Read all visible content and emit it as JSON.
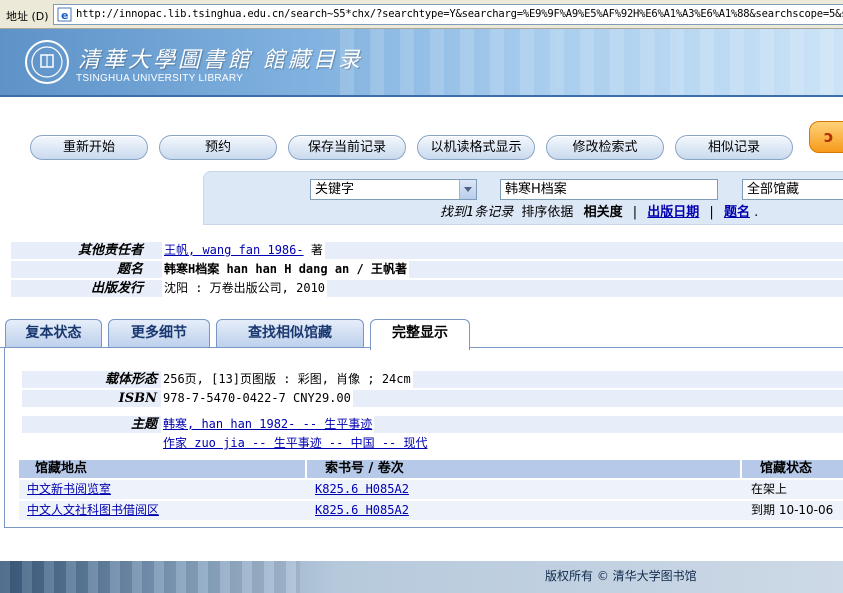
{
  "address_bar": {
    "label": "地址 (D)",
    "url": "http://innopac.lib.tsinghua.edu.cn/search~S5*chx/?searchtype=Y&searcharg=%E9%9F%A9%E5%AF%92H%E6%A1%A3%E6%A1%88&searchscope=5&sor"
  },
  "header": {
    "title_cn": "清華大學圖書館 館藏目录",
    "title_en": "TSINGHUA UNIVERSITY LIBRARY"
  },
  "toolbar": {
    "buttons": [
      {
        "label": "重新开始"
      },
      {
        "label": "预约"
      },
      {
        "label": "保存当前记录"
      },
      {
        "label": "以机读格式显示"
      },
      {
        "label": "修改检索式"
      },
      {
        "label": "相似记录"
      }
    ]
  },
  "search": {
    "type_value": "关键字",
    "query": "韩寒H档案",
    "scope_value": "全部馆藏",
    "found_text": "找到1条记录",
    "sort_label": "排序依据",
    "sort_relevance": "相关度",
    "sort_date": "出版日期",
    "sort_title": "题名",
    "separator": "|",
    "end_dot": "."
  },
  "record_summary": [
    {
      "label": "其他责任者",
      "link": "王帆, wang fan 1986-",
      "suffix": " 著"
    },
    {
      "label": "题名",
      "text": "韩寒H档案 han han H dang an / 王帆著"
    },
    {
      "label": "出版发行",
      "text": "沈阳 : 万卷出版公司, 2010"
    }
  ],
  "tabs": [
    {
      "label": "复本状态"
    },
    {
      "label": "更多细节"
    },
    {
      "label": "查找相似馆藏"
    },
    {
      "label": "完整显示"
    }
  ],
  "full_record": {
    "physical_label": "载体形态",
    "physical_value": "256页, [13]页图版 : 彩图, 肖像 ; 24cm",
    "isbn_label": "ISBN",
    "isbn_value": "978-7-5470-0422-7 CNY29.00",
    "subject_label": "主题",
    "subjects": [
      "韩寒, han han 1982- -- 生平事迹",
      "作家 zuo jia -- 生平事迹 -- 中国 -- 现代"
    ]
  },
  "holdings": {
    "headers": [
      "馆藏地点",
      "索书号 / 卷次",
      "馆藏状态"
    ],
    "rows": [
      {
        "location": "中文新书阅览室",
        "call_no": "K825.6 H085A2",
        "status": "在架上"
      },
      {
        "location": "中文人文社科图书借阅区",
        "call_no": "K825.6 H085A2",
        "status": "到期 10-10-06"
      }
    ]
  },
  "footer": {
    "copyright": "版权所有 © 清华大学图书馆"
  }
}
